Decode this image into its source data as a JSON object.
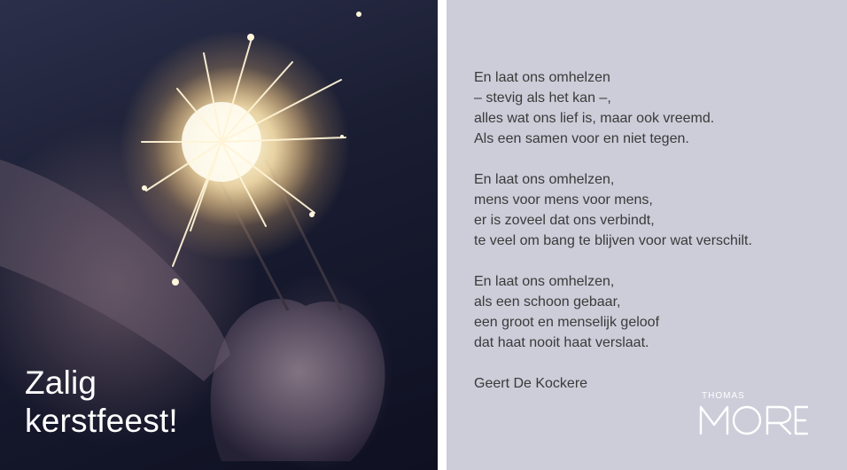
{
  "photo": {
    "greeting_line1": "Zalig",
    "greeting_line2": "kerstfeest!"
  },
  "poem": {
    "stanzas": [
      {
        "lines": [
          "En laat ons omhelzen",
          "– stevig als het kan –,",
          "alles wat ons lief is, maar ook vreemd.",
          "Als een samen voor en niet tegen."
        ]
      },
      {
        "lines": [
          "En laat ons omhelzen,",
          "mens voor mens voor mens,",
          "er is zoveel dat ons verbindt,",
          "te veel om bang te blijven voor wat verschilt."
        ]
      },
      {
        "lines": [
          "En laat ons omhelzen,",
          "als een schoon gebaar,",
          "een groot en menselijk geloof",
          "dat haat nooit haat verslaat."
        ]
      }
    ],
    "author": "Geert De Kockere"
  },
  "logo": {
    "small_text": "THOMAS",
    "large_text": "MORE"
  },
  "colors": {
    "panel_background": "#cccdd9",
    "poem_text": "#3a3a3a",
    "greeting_text": "#ffffff",
    "photo_dark": "#14162a"
  }
}
